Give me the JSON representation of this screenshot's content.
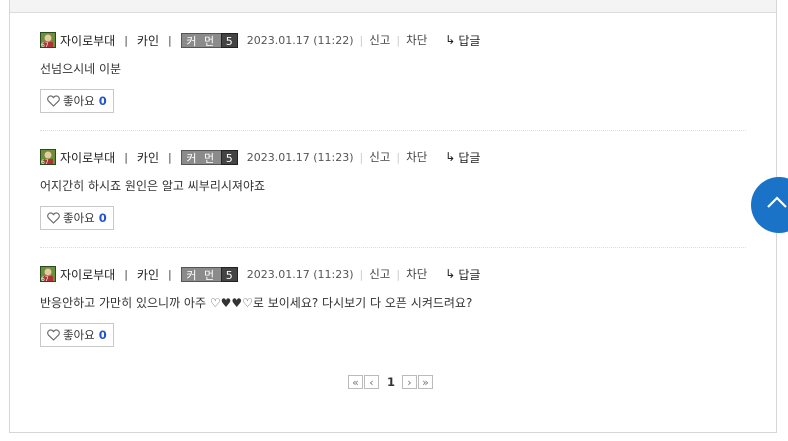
{
  "comments": [
    {
      "nickname": "자이로부대",
      "name": "카인",
      "badge_label": "커 먼",
      "badge_level": "5",
      "date": "2023.01.17 (11:22)",
      "report": "신고",
      "block": "차단",
      "reply": "답글",
      "text": "선넘으시네 이분",
      "like_label": "좋아요",
      "like_count": "0"
    },
    {
      "nickname": "자이로부대",
      "name": "카인",
      "badge_label": "커 먼",
      "badge_level": "5",
      "date": "2023.01.17 (11:23)",
      "report": "신고",
      "block": "차단",
      "reply": "답글",
      "text": "어지간히 하시죠 원인은 알고 씨부리시져야죠",
      "like_label": "좋아요",
      "like_count": "0"
    },
    {
      "nickname": "자이로부대",
      "name": "카인",
      "badge_label": "커 먼",
      "badge_level": "5",
      "date": "2023.01.17 (11:23)",
      "report": "신고",
      "block": "차단",
      "reply": "답글",
      "text": "반응안하고 가만히 있으니까 아주 ♡♥♥♡로 보이세요? 다시보기 다 오픈 시켜드려요?",
      "like_label": "좋아요",
      "like_count": "0"
    }
  ],
  "pagination": {
    "first": "«",
    "prev": "‹",
    "current": "1",
    "next": "›",
    "last": "»"
  },
  "colors": {
    "accent": "#1a73c6",
    "like_count": "#2255cc",
    "badge_bg": "#8b8b8b",
    "badge_level_bg": "#444444"
  },
  "icons": {
    "avatar": "game-character-avatar-icon",
    "heart": "heart-outline-icon",
    "reply": "reply-arrow-icon",
    "scroll_top": "chevron-up-icon"
  }
}
